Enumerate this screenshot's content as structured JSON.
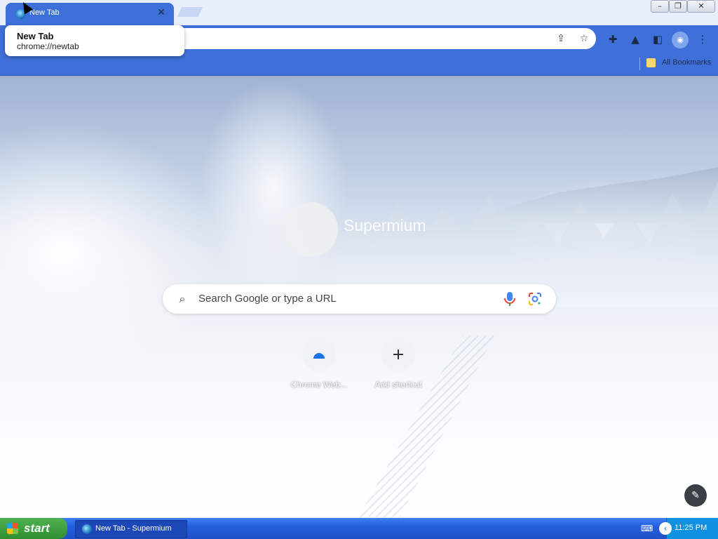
{
  "tab": {
    "title": "New Tab",
    "close_icon": "close-icon"
  },
  "tooltip": {
    "title": "New Tab",
    "url": "chrome://newtab"
  },
  "window_controls": {
    "minimize": "–",
    "restore": "❐",
    "close": "✕"
  },
  "omnibox": {
    "share_icon": "share-icon",
    "star_icon": "star-icon"
  },
  "toolbar": {
    "extensions_icon": "puzzle-icon",
    "labs_icon": "flask-icon",
    "sidepanel_icon": "side-panel-icon",
    "profile_icon": "profile-icon",
    "menu_icon": "kebab-menu-icon"
  },
  "bookmarks": {
    "all_label": "All Bookmarks"
  },
  "newtab": {
    "logo_text": "Supermium",
    "search_placeholder": "Search Google or type a URL",
    "shortcuts": [
      {
        "label": "Chrome Web...",
        "icon": "chrome-web-store-icon"
      },
      {
        "label": "Add shortcut",
        "icon": "plus-icon"
      }
    ],
    "edit_icon": "pencil-icon"
  },
  "taskbar": {
    "start_label": "start",
    "task_label": "New Tab - Supermium",
    "time": "11:25 PM"
  },
  "colors": {
    "tab_active": "#3d6fd9",
    "toolbar": "#3f6fd8",
    "taskbar": "#245edc",
    "start_green": "#2f8e2f"
  }
}
